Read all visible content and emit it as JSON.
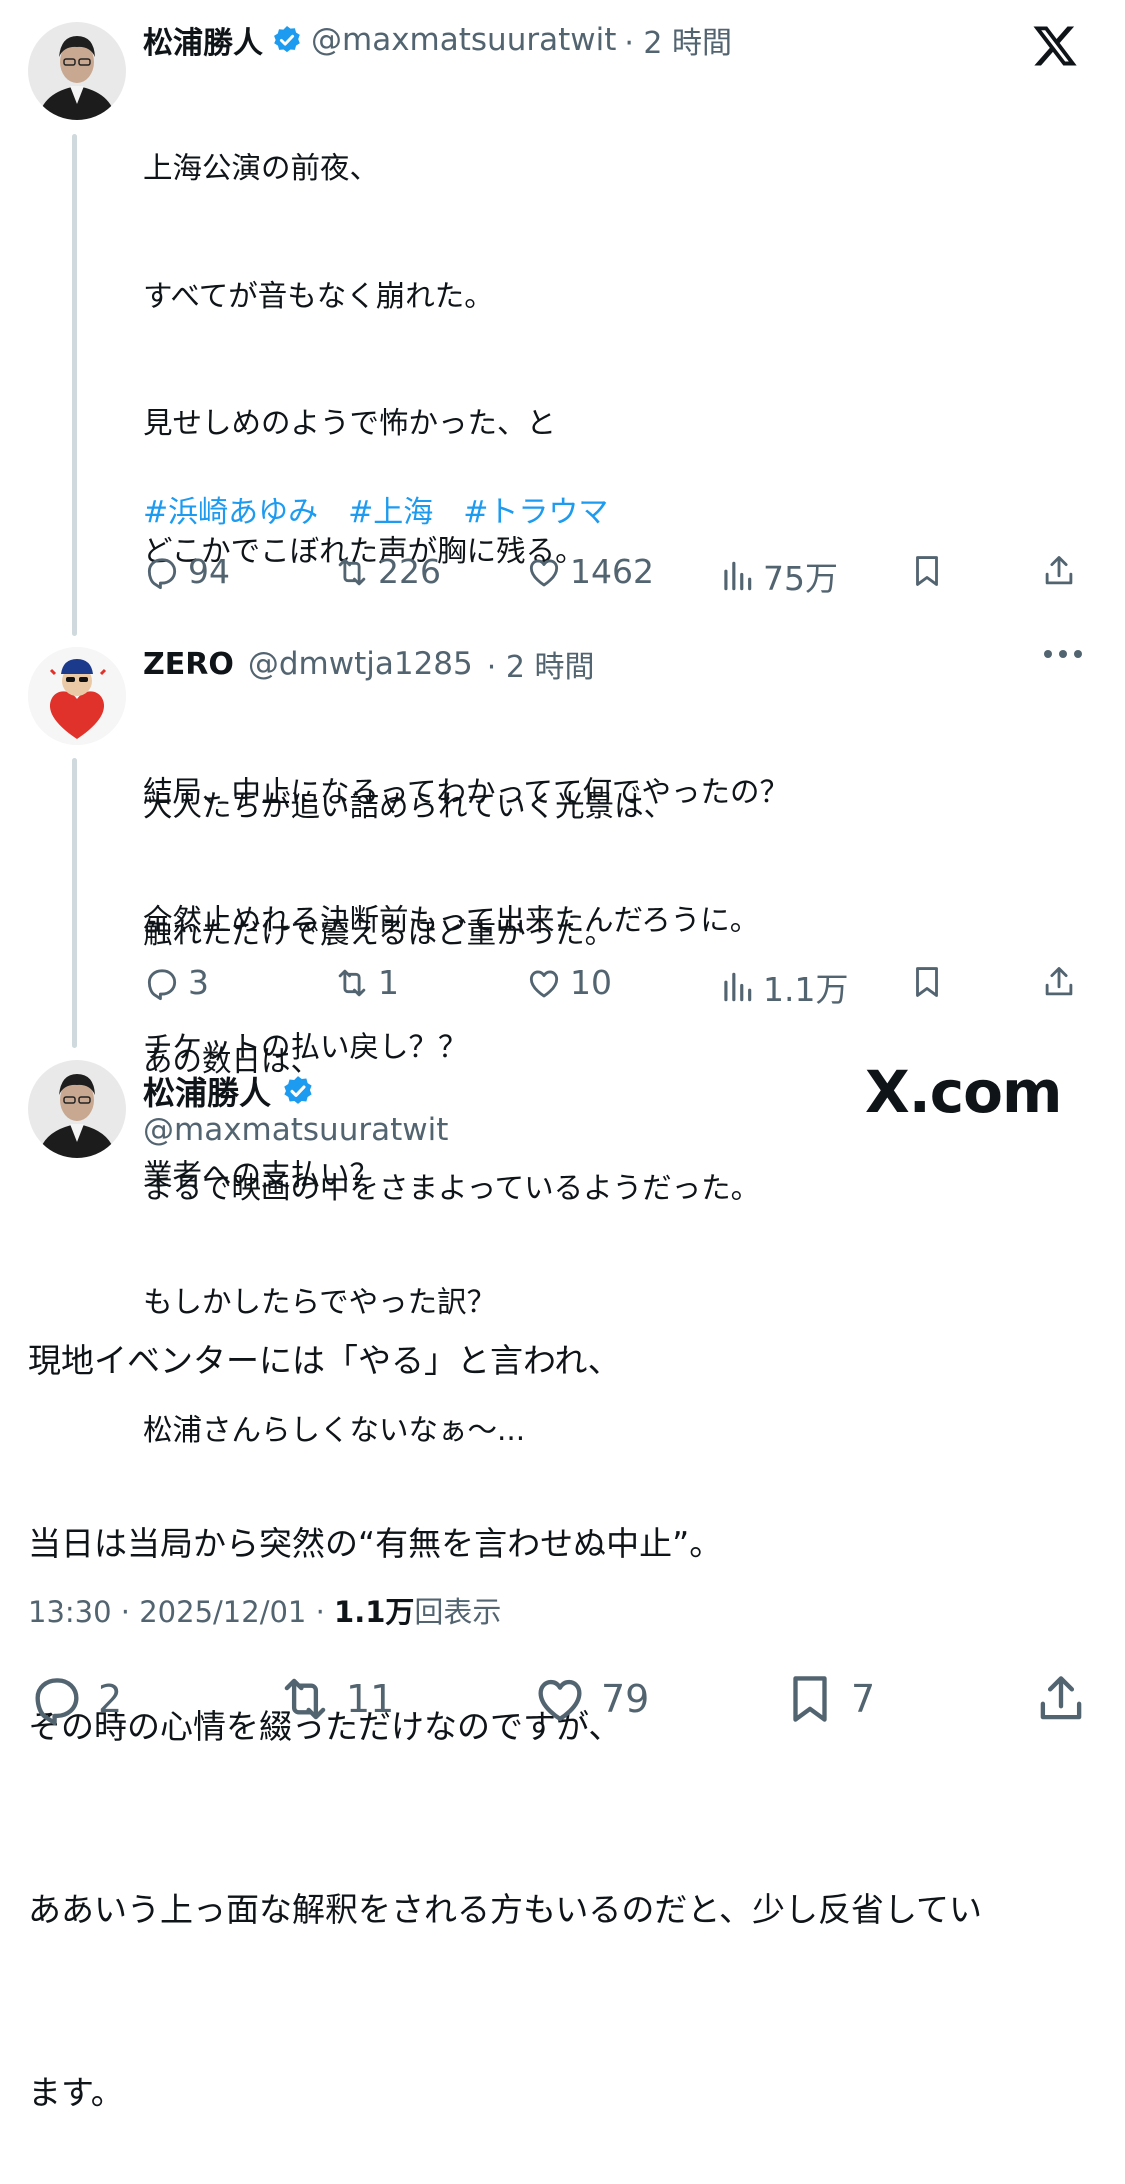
{
  "tweet1": {
    "name": "松浦勝人",
    "handle": "@maxmatsuuratwit",
    "time": "· 2 時間",
    "lines": [
      "上海公演の前夜、",
      "すべてが音もなく崩れた。",
      "見せしめのようで怖かった、と",
      "どこかでこぼれた声が胸に残る。",
      "",
      "大人たちが追い詰められていく光景は、",
      "触れただけで震えるほど重かった。",
      "あの数日は、",
      "まるで映画の中をさまよっているようだった。"
    ],
    "hashtags": [
      "#浜崎あゆみ",
      "#上海",
      "#トラウマ"
    ],
    "replies": "94",
    "retweets": "226",
    "likes": "1462",
    "views": "75万"
  },
  "tweet2": {
    "name": "ZERO",
    "handle": "@dmwtja1285",
    "time": "· 2 時間",
    "lines": [
      "結局、中止になるってわかってて何でやったの？",
      "全然止めれる決断前もって出来たんだろうに。",
      "チケットの払い戻し？？",
      "業者への支払い？",
      "もしかしたらでやった訳？",
      "松浦さんらしくないなぁ〜..."
    ],
    "replies": "3",
    "retweets": "1",
    "likes": "10",
    "views": "1.1万"
  },
  "tweet3": {
    "name": "松浦勝人",
    "handle": "@maxmatsuuratwit",
    "watermark": "X.com",
    "lines": [
      "現地イベンターには「やる」と言われ、",
      "当日は当局から突然の“有無を言わせぬ中止”。",
      "その時の心情を綴っただけなのですが、",
      "ああいう上っ面な解釈をされる方もいるのだと、少し反省してい",
      "ます。"
    ],
    "timestamp": "13:30 · 2025/12/01 · ",
    "views_count": "1.1万",
    "views_label": "回表示",
    "replies": "2",
    "retweets": "11",
    "likes": "79",
    "bookmarks": "7"
  },
  "colors": {
    "verified": "#1d9bf0",
    "hashtag": "#1d9bf0",
    "muted": "#536471"
  },
  "icons": [
    "x-logo-icon",
    "verified-badge-icon",
    "reply-icon",
    "retweet-icon",
    "like-icon",
    "views-icon",
    "bookmark-icon",
    "share-icon",
    "more-icon"
  ]
}
